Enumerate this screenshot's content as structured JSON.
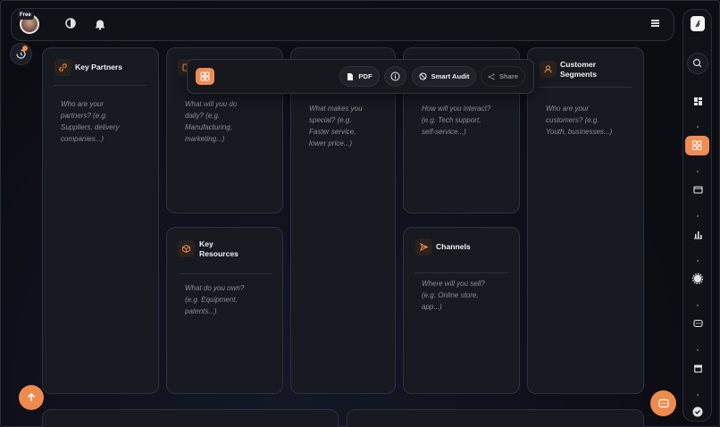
{
  "header": {
    "plan_badge": "Free",
    "avatar_icon": "user-avatar",
    "theme_icon": "contrast-icon",
    "notification_icon": "bell-icon",
    "menu_icon": "hamburger-icon"
  },
  "toolbar": {
    "pdf_label": "PDF",
    "audit_label": "Smart Audit",
    "share_label": "Share"
  },
  "canvas": {
    "key_partners": {
      "title": "Key Partners",
      "prompt": "Who are your\npartners? (e.g.\nSuppliers, delivery\ncompanies...)",
      "icon": "link-icon"
    },
    "key_activities": {
      "prompt": "What will you do\ndaily? (e.g.\nManufacturing,\nmarketing...)",
      "icon": "checklist-icon"
    },
    "key_resources": {
      "title": "Key\nResources",
      "prompt": "What do you own?\n(e.g. Equipment,\npatents...)",
      "icon": "box-icon"
    },
    "value_propositions": {
      "prompt": "What makes you\nspecial? (e.g.\nFaster service,\nlower price...)",
      "icon": "gift-icon"
    },
    "customer_relationships": {
      "prompt": "How will you interact?\n(e.g. Tech support,\nself-service...)",
      "icon": "heart-icon"
    },
    "channels": {
      "title": "Channels",
      "prompt": "Where will you sell?\n(e.g. Online store,\napp...)",
      "icon": "send-icon"
    },
    "customer_segments": {
      "title": "Customer\nSegments",
      "prompt": "Who are your\ncustomers? (e.g.\nYouth, businesses...)",
      "icon": "person-icon"
    }
  },
  "sidebar": {
    "items": [
      "search-icon",
      "dashboard-icon",
      "canvas-icon",
      "wallet-icon",
      "bar-chart-icon",
      "settings-icon",
      "chat-icon",
      "archive-icon",
      "check-circle-icon"
    ]
  },
  "colors": {
    "accent": "#f08c54",
    "background": "#0d0e14",
    "card": "#181a22"
  }
}
